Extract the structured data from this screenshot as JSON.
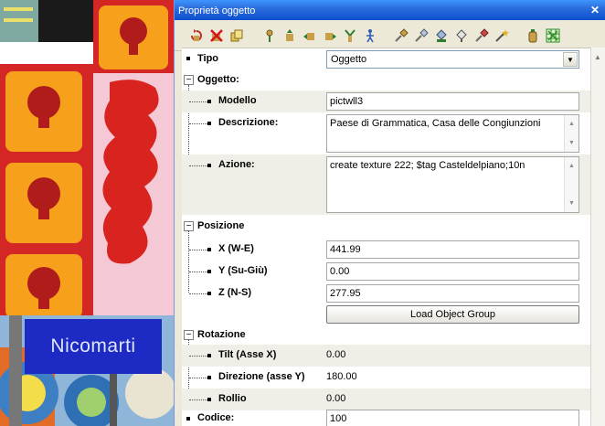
{
  "viewport": {
    "sign_text": "Nicomarti"
  },
  "window": {
    "title": "Proprietà oggetto",
    "close_glyph": "✕"
  },
  "toolbar": {
    "icons": [
      "rotate-icon",
      "delete-icon",
      "clone-icon",
      "pin-icon",
      "move-icon",
      "move-up-icon",
      "move-down-icon",
      "light-icon",
      "person-icon",
      "brush-icon",
      "brush-alt-icon",
      "bucket-icon",
      "select-icon",
      "paint-icon",
      "wand-icon",
      "bottle-icon",
      "grid-icon"
    ]
  },
  "properties": {
    "tipo": {
      "label": "Tipo",
      "value": "Oggetto"
    },
    "oggetto": {
      "label": "Oggetto:",
      "modello": {
        "label": "Modello",
        "value": "pictwll3"
      },
      "descrizione": {
        "label": "Descrizione:",
        "value": "Paese di Grammatica, Casa delle Congiunzioni"
      },
      "azione": {
        "label": "Azione:",
        "value": "create texture 222; $tag Casteldelpiano;10n"
      }
    },
    "posizione": {
      "label": "Posizione",
      "x": {
        "label": "X (W-E)",
        "value": "441.99"
      },
      "y": {
        "label": "Y (Su-Giù)",
        "value": "0.00"
      },
      "z": {
        "label": "Z (N-S)",
        "value": "277.95"
      },
      "load_button": "Load Object Group"
    },
    "rotazione": {
      "label": "Rotazione",
      "tilt": {
        "label": "Tilt (Asse X)",
        "value": "0.00"
      },
      "direzione": {
        "label": "Direzione (asse Y)",
        "value": "180.00"
      },
      "rollio": {
        "label": "Rollio",
        "value": "0.00"
      }
    },
    "codice": {
      "label": "Codice:",
      "value": "100"
    }
  },
  "glyphs": {
    "expander_open": "−",
    "dropdown_arrow": "▼",
    "scroll_up": "▲",
    "scroll_down": "▼"
  }
}
